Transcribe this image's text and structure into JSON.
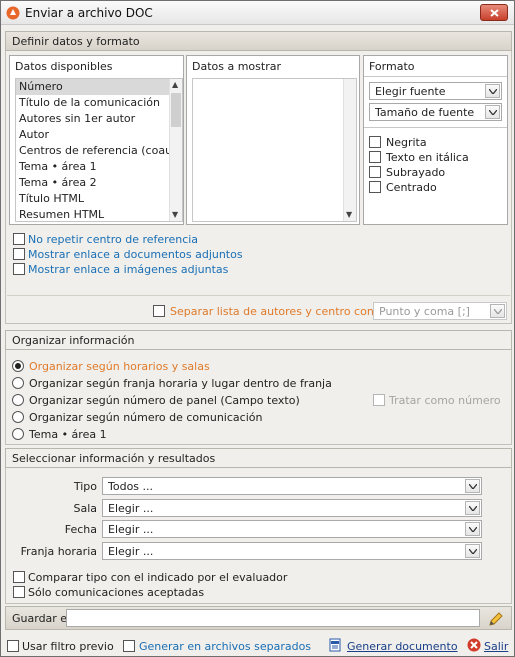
{
  "window": {
    "title": "Enviar a archivo DOC"
  },
  "define": {
    "header": "Definir datos y formato",
    "available_title": "Datos disponibles",
    "available_items": [
      "Número",
      "Título de la comunicación",
      "Autores sin 1er autor",
      "Autor",
      "Centros de referencia (coautores)",
      "Tema • área 1",
      "Tema • área 2",
      "Título HTML",
      "Resumen HTML"
    ],
    "show_title": "Datos a mostrar",
    "format_title": "Formato",
    "font_select": "Elegir fuente",
    "size_select": "Tamaño de fuente",
    "bold": "Negrita",
    "italic": "Texto en itálica",
    "underline": "Subrayado",
    "center": "Centrado",
    "no_repeat": "No repetir centro de referencia",
    "show_docs": "Mostrar enlace a documentos adjuntos",
    "show_images": "Mostrar enlace a imágenes adjuntas",
    "separate_label": "Separar lista de autores y centro con",
    "separate_select": "Punto y coma [;]"
  },
  "organize": {
    "header": "Organizar información",
    "options": [
      "Organizar según horarios y salas",
      "Organizar según franja horaria y lugar dentro de franja",
      "Organizar según número de panel (Campo texto)",
      "Organizar según número de comunicación",
      "Tema • área 1"
    ],
    "treat_as_number": "Tratar como número"
  },
  "select": {
    "header": "Seleccionar información y resultados",
    "tipo_label": "Tipo",
    "tipo_value": "Todos ...",
    "sala_label": "Sala",
    "sala_value": "Elegir ...",
    "fecha_label": "Fecha",
    "fecha_value": "Elegir ...",
    "franja_label": "Franja horaria",
    "franja_value": "Elegir ...",
    "compare": "Comparar tipo con el indicado por el evaluador",
    "accepted": "Sólo comunicaciones aceptadas"
  },
  "save": {
    "label": "Guardar en",
    "value": ""
  },
  "footer": {
    "prev_filter": "Usar filtro previo",
    "separate_files": "Generar en archivos separados",
    "generate": "Generar documento",
    "exit": "Salir"
  },
  "colors": {
    "link": "#1a6fb5",
    "highlight": "#e07a2a",
    "close": "#c7402c"
  }
}
